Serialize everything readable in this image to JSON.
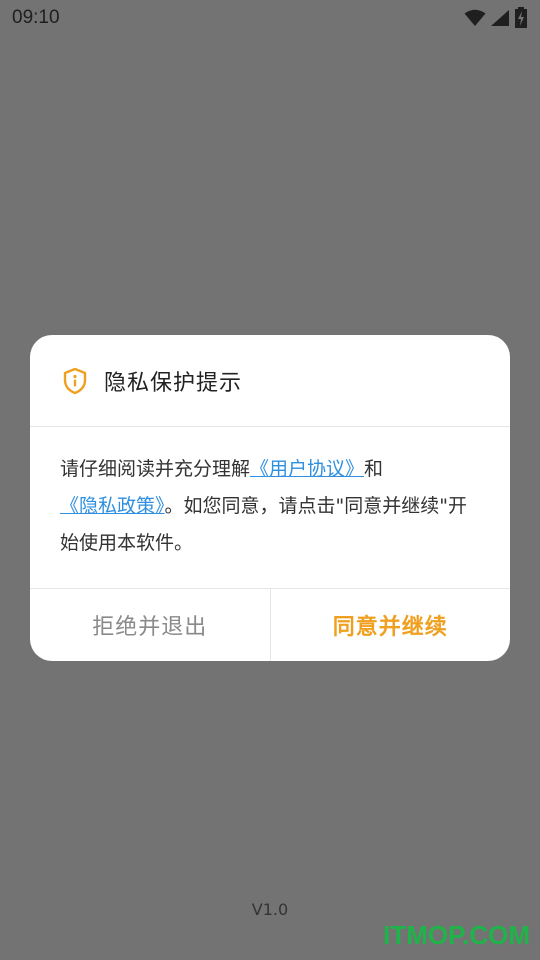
{
  "status_bar": {
    "time": "09:10",
    "icons": [
      "wifi-icon",
      "signal-icon",
      "battery-charging-icon"
    ]
  },
  "dialog": {
    "icon": "shield-info-icon",
    "title": "隐私保护提示",
    "body": {
      "prefix": "请仔细阅读并充分理解",
      "user_agreement_link": "《用户协议》",
      "and": "和",
      "privacy_policy_link": "《隐私政策》",
      "suffix": "。如您同意，请点击\"同意并继续\"开始使用本软件。"
    },
    "reject_button": "拒绝并退出",
    "agree_button": "同意并继续"
  },
  "version": "V1.0",
  "watermark": "ITMOP.COM",
  "colors": {
    "overlay": "#737373",
    "accent": "#f0a020",
    "link": "#2f8fe0",
    "watermark": "#1fb34a"
  }
}
